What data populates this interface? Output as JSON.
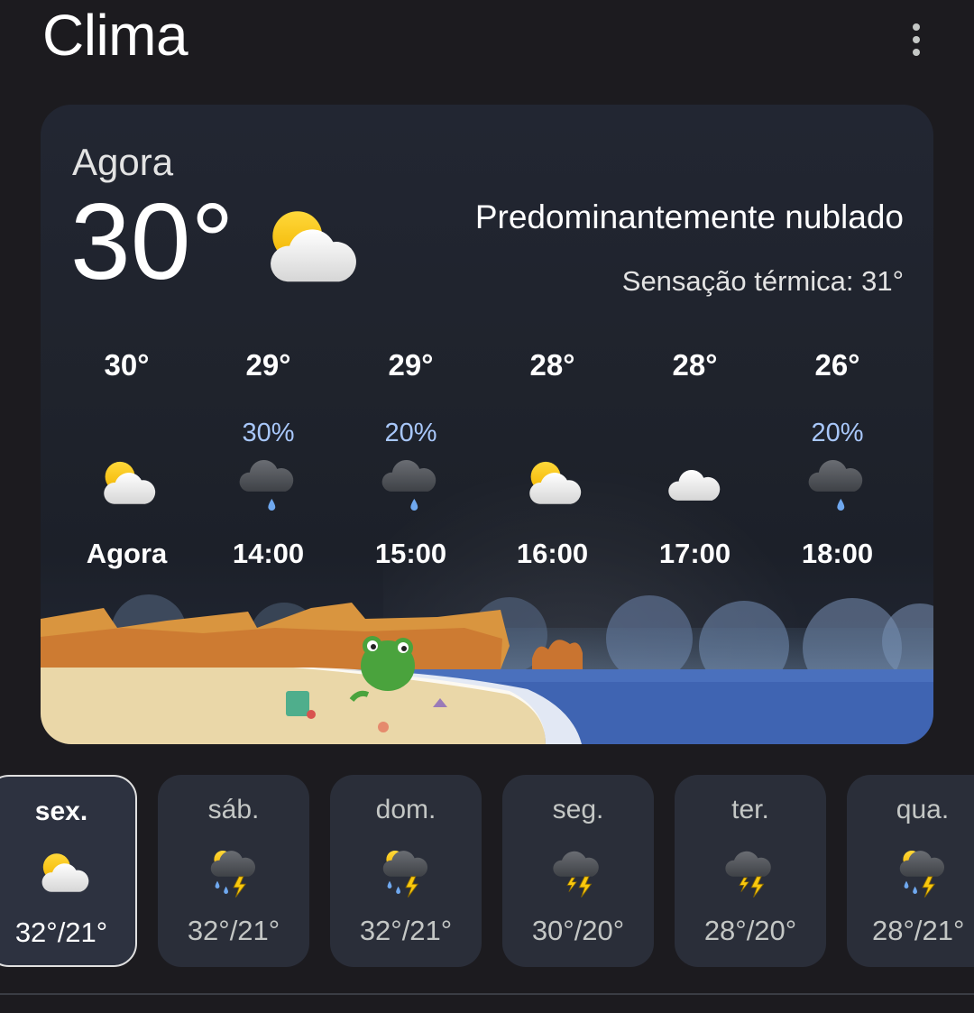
{
  "header": {
    "title": "Clima",
    "menu_icon": "more-vert-icon"
  },
  "current": {
    "label": "Agora",
    "temperature": "30°",
    "icon": "partly-cloudy-icon",
    "condition": "Predominantemente nublado",
    "feels_like": "Sensação térmica: 31°"
  },
  "hourly": [
    {
      "temp": "30°",
      "precip": "",
      "icon": "partly-cloudy-icon",
      "time": "Agora"
    },
    {
      "temp": "29°",
      "precip": "30%",
      "icon": "rain-cloud-icon",
      "time": "14:00"
    },
    {
      "temp": "29°",
      "precip": "20%",
      "icon": "rain-cloud-icon",
      "time": "15:00"
    },
    {
      "temp": "28°",
      "precip": "",
      "icon": "partly-cloudy-icon",
      "time": "16:00"
    },
    {
      "temp": "28°",
      "precip": "",
      "icon": "cloud-icon",
      "time": "17:00"
    },
    {
      "temp": "26°",
      "precip": "20%",
      "icon": "rain-cloud-icon",
      "time": "18:00"
    }
  ],
  "daily": [
    {
      "day": "sex.",
      "range": "32°/21°",
      "icon": "partly-cloudy-icon",
      "selected": true
    },
    {
      "day": "sáb.",
      "range": "32°/21°",
      "icon": "thunderstorm-rain-icon",
      "selected": false
    },
    {
      "day": "dom.",
      "range": "32°/21°",
      "icon": "thunderstorm-rain-icon",
      "selected": false
    },
    {
      "day": "seg.",
      "range": "30°/20°",
      "icon": "thunderstorm-icon",
      "selected": false
    },
    {
      "day": "ter.",
      "range": "28°/20°",
      "icon": "thunderstorm-icon",
      "selected": false
    },
    {
      "day": "qua.",
      "range": "28°/21°",
      "icon": "thunderstorm-rain-icon",
      "selected": false
    }
  ],
  "colors": {
    "background": "#1c1b1f",
    "card": "#222632",
    "precip_text": "#a8c7fa",
    "sun": "#f9c80e",
    "ocean": "#3f64b2"
  }
}
